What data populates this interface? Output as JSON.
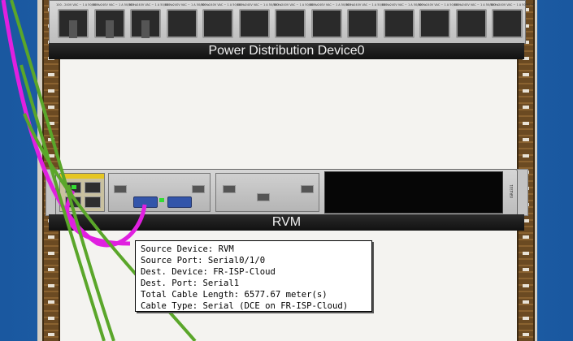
{
  "pdu": {
    "label": "Power Distribution Device0",
    "outlet_count": 13,
    "outlet_rating": "100 - 240V VAC ~ 1 A 50/60 Hz"
  },
  "router": {
    "label": "RVM",
    "side_text": "ISR4331"
  },
  "tooltip": {
    "source_device": "Source Device: RVM",
    "source_port": "Source Port: Serial0/1/0",
    "dest_device": "Dest. Device: FR-ISP-Cloud",
    "dest_port": "Dest. Port: Serial1",
    "cable_length": "Total Cable Length: 6577.67 meter(s)",
    "cable_type": "Cable Type: Serial (DCE on FR-ISP-Cloud)"
  },
  "colors": {
    "serial_cable": "#e020e0",
    "power_cable": "#5aa62a",
    "background": "#1f5fa0"
  }
}
